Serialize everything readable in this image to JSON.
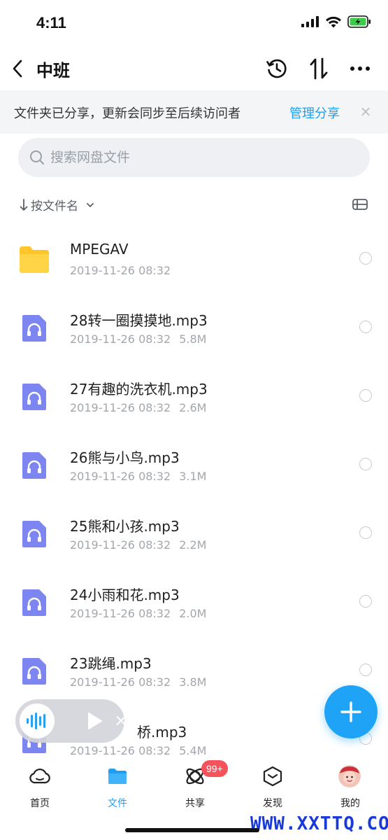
{
  "status_bar": {
    "time": "4:11"
  },
  "nav": {
    "title": "中班"
  },
  "share_banner": {
    "message": "文件夹已分享，更新会同步至后续访问者",
    "manage_link": "管理分享",
    "close": "×"
  },
  "search": {
    "placeholder": "搜索网盘文件"
  },
  "sort": {
    "label": "按文件名"
  },
  "files": [
    {
      "name": "MPEGAV",
      "date": "2019-11-26 08:32",
      "size": "",
      "type": "folder"
    },
    {
      "name": "28转一圈摸摸地.mp3",
      "date": "2019-11-26 08:32",
      "size": "5.8M",
      "type": "audio"
    },
    {
      "name": "27有趣的洗衣机.mp3",
      "date": "2019-11-26 08:32",
      "size": "2.6M",
      "type": "audio"
    },
    {
      "name": "26熊与小鸟.mp3",
      "date": "2019-11-26 08:32",
      "size": "3.1M",
      "type": "audio"
    },
    {
      "name": "25熊和小孩.mp3",
      "date": "2019-11-26 08:32",
      "size": "2.2M",
      "type": "audio"
    },
    {
      "name": "24小雨和花.mp3",
      "date": "2019-11-26 08:32",
      "size": "2.0M",
      "type": "audio"
    },
    {
      "name": "23跳绳.mp3",
      "date": "2019-11-26 08:32",
      "size": "3.8M",
      "type": "audio"
    },
    {
      "name": "桥.mp3",
      "date": "2019-11-26 08:32",
      "size": "5.4M",
      "type": "audio"
    }
  ],
  "player": {
    "close": "×"
  },
  "tabs": [
    {
      "label": "首页",
      "icon": "cloud-icon",
      "active": false
    },
    {
      "label": "文件",
      "icon": "folder-icon",
      "active": true
    },
    {
      "label": "共享",
      "icon": "orbit-icon",
      "active": false
    },
    {
      "label": "发现",
      "icon": "discover-icon",
      "active": false
    },
    {
      "label": "我的",
      "icon": "avatar",
      "active": false
    }
  ],
  "share_badge": "99+",
  "watermark": "WWW.XXTTQ.COM",
  "colors": {
    "accent": "#1e9ef5",
    "folder": "#ffc62b",
    "audio_icon": "#7d86f0",
    "badge": "#f5535b"
  }
}
